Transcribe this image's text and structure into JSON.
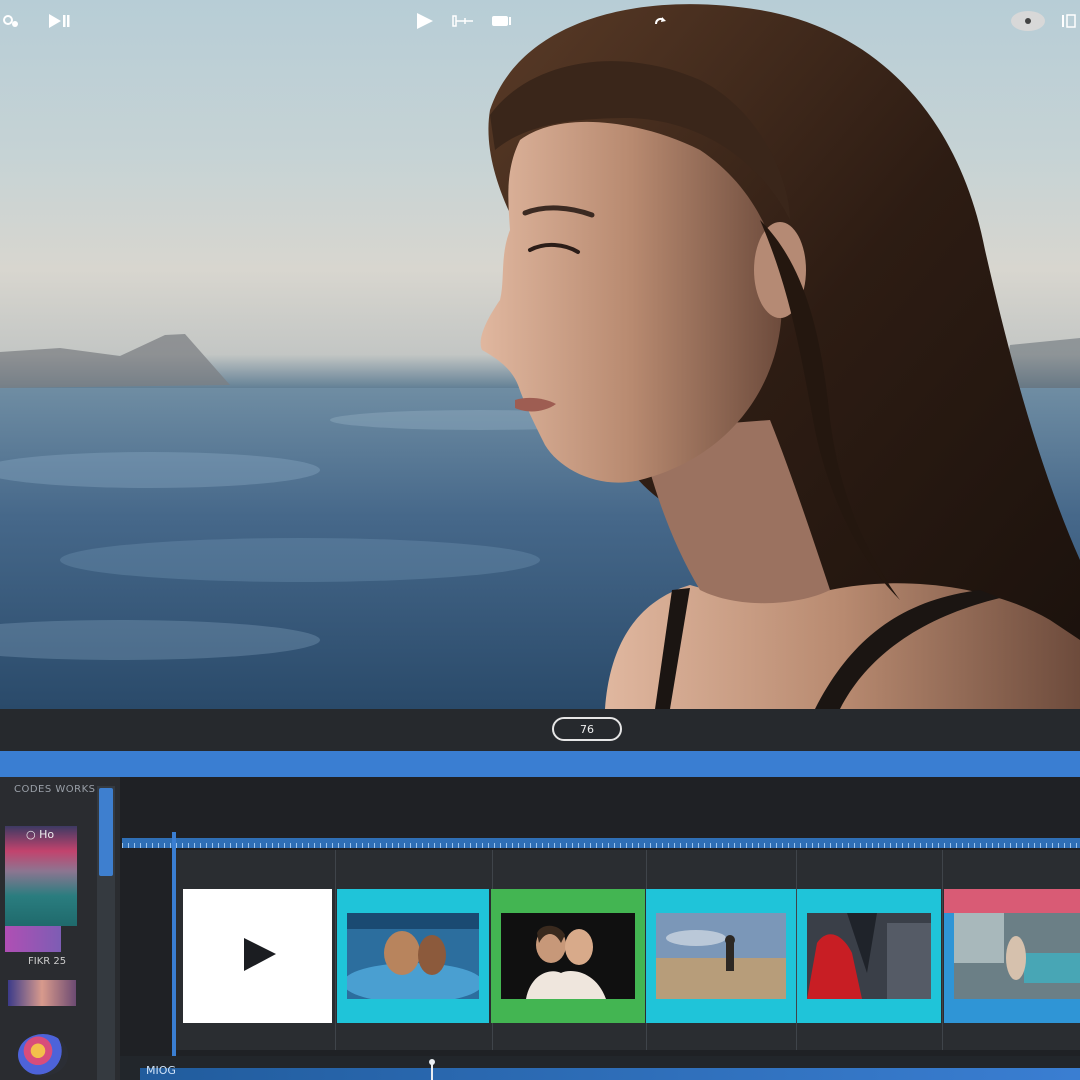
{
  "toolbar": {
    "counter_value": "76"
  },
  "left_panel": {
    "title": "CODES WORKS",
    "swatch_label": "○ Ho",
    "effects_label": "FIKR 25"
  },
  "timeline": {
    "clips": [
      {
        "name": "white-play-clip",
        "border": "#ffffff"
      },
      {
        "name": "swimmers-clip",
        "border": "#1fc4d9"
      },
      {
        "name": "couple-portrait-clip",
        "border": "#43b552"
      },
      {
        "name": "desert-figure-clip",
        "border": "#1fc4d9"
      },
      {
        "name": "red-dress-clip",
        "border": "#1fc4d9"
      },
      {
        "name": "bedroom-clip",
        "border": "#d95b75"
      }
    ],
    "track_label": "MIOG"
  },
  "colors": {
    "accent_blue": "#3a7ed2",
    "toolbar_bg": "#26292d",
    "clip_cyan": "#1fc4d9",
    "clip_green": "#43b552",
    "clip_pink": "#d95b75"
  }
}
